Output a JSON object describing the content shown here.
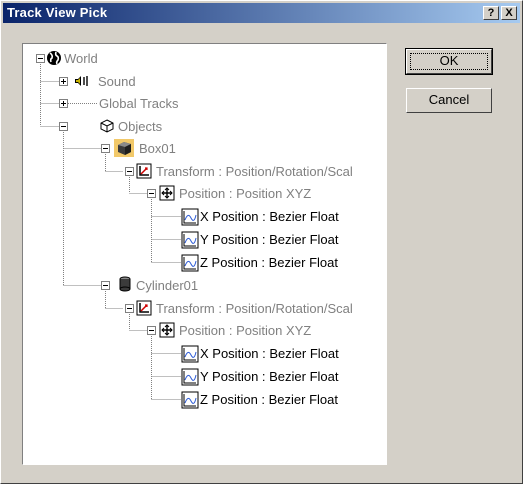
{
  "window": {
    "title": "Track View Pick",
    "help_glyph": "?",
    "close_glyph": "X"
  },
  "buttons": {
    "ok": "OK",
    "cancel": "Cancel"
  },
  "tree": [
    {
      "label": "World",
      "icon": "globe-icon",
      "style": "gray",
      "expander": "minus"
    },
    {
      "label": "Sound",
      "icon": "speaker-icon",
      "style": "gray",
      "expander": "plus"
    },
    {
      "label": "Global Tracks",
      "icon": "",
      "style": "gray",
      "expander": "plus"
    },
    {
      "label": "Objects",
      "icon": "objects-icon",
      "style": "gray",
      "expander": "minus"
    },
    {
      "label": "Box01",
      "icon": "box-icon",
      "style": "gray",
      "expander": "minus"
    },
    {
      "label": "Transform : Position/Rotation/Scal",
      "icon": "transform-icon",
      "style": "gray",
      "expander": "minus"
    },
    {
      "label": "Position : Position XYZ",
      "icon": "position-icon",
      "style": "gray",
      "expander": "minus"
    },
    {
      "label": "X Position : Bezier Float",
      "icon": "curve-icon",
      "style": "black",
      "expander": ""
    },
    {
      "label": "Y Position : Bezier Float",
      "icon": "curve-icon",
      "style": "black",
      "expander": ""
    },
    {
      "label": "Z Position : Bezier Float",
      "icon": "curve-icon",
      "style": "black",
      "expander": ""
    },
    {
      "label": "Cylinder01",
      "icon": "cylinder-icon",
      "style": "gray",
      "expander": "minus"
    },
    {
      "label": "Transform : Position/Rotation/Scal",
      "icon": "transform-icon",
      "style": "gray",
      "expander": "minus"
    },
    {
      "label": "Position : Position XYZ",
      "icon": "position-icon",
      "style": "gray",
      "expander": "minus"
    },
    {
      "label": "X Position : Bezier Float",
      "icon": "curve-icon",
      "style": "black",
      "expander": ""
    },
    {
      "label": "Y Position : Bezier Float",
      "icon": "curve-icon",
      "style": "black",
      "expander": ""
    },
    {
      "label": "Z Position : Bezier Float",
      "icon": "curve-icon",
      "style": "black",
      "expander": ""
    }
  ]
}
